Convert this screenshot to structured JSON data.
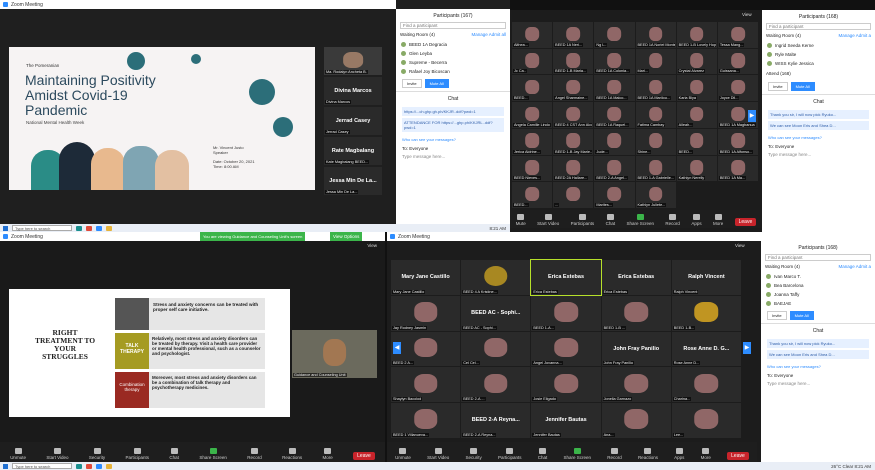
{
  "q1": {
    "window_title": "Zoom Meeting",
    "slide": {
      "brand": "The Pomeranian",
      "title1": "Maintaining Positivity",
      "title2": "Amidst Covid-19",
      "title3": "Pandemic",
      "subtitle": "National Mental Health Week",
      "speaker1": "Mr. Vincent Justo",
      "speaker2": "Speaker",
      "date": "Date: October 20, 2021",
      "time": "Time: 8:00 AM"
    },
    "side": [
      {
        "big": "",
        "name": "Ma. Rodalyn Ancheta B."
      },
      {
        "big": "Divina Marcos",
        "name": "Divina Marcos"
      },
      {
        "big": "Jerrad Casey",
        "name": "Jerrad Casey"
      },
      {
        "big": "Rate Magbalang",
        "name": "Kate Magbalang BEED..."
      },
      {
        "big": "Jessa Min De La...",
        "name": "Jessa Min De La..."
      }
    ],
    "panel": {
      "header": "Participants (167)",
      "search": "Find a participant",
      "waiting": "Waiting Room (4)",
      "manage": "Manage",
      "admit": "Admit all",
      "people": [
        "BEED 1A Degracia",
        "Glen Leyba",
        "Supreme - Becerra",
        "Rafael Joy Bicoscan"
      ],
      "btn1": "Invite",
      "btn2": "Mute All",
      "chat_header": "Chat",
      "msg1": "https://...ch.ghp.gh.ph/KKJR..ddf?pwd=1",
      "msg2": "ATTENDANCE FOR https://...ghp.ph/KKJRL..ddf?pwd=1",
      "to": "To: Everyone",
      "type": "Type message here...",
      "who": "Who can see your messages?"
    }
  },
  "q2": {
    "view": "View",
    "tiles": [
      "Althea...",
      "BEED 1A Neri...",
      "Ng L..",
      "BEED 1A Noriel Montes...",
      "BEED 1-B Lovely Hope...",
      "Tessa Mang...",
      "Jc Ca..",
      "BEED 1-B Maria...",
      "BEED 1A Colonia...",
      "Mari...",
      "Crystal Alvarez",
      "Guissana...",
      "BEED...",
      "Angel Sharmaine...",
      "BEED 1A Malco...",
      "BEED 1A Marilou...",
      "Karla Biya",
      "Joyce Dil...",
      "Angela Camille Lindo",
      "BEED 4 CST Ann Alcone",
      "BEED 1A Raquel...",
      "Fatima Cambay",
      "Alleah...",
      "BEED 1A Magbanua",
      "Jerica Aldrine...",
      "BEED 1-B Jay Marie...",
      "Jude...",
      "Shine...",
      "BEED...",
      "BEED 1A Alfonso...",
      "BEED Nieves...",
      "BEED 2A Hallare...",
      "BEED 2-A Angel...",
      "BEED 1-A Gabrielle...",
      "Kathlyn Nerelly",
      "BEED 1A Ma...",
      "BEED...",
      "...",
      "Marites...",
      "Kathlyn Juliete..."
    ],
    "panel": {
      "header": "Participants (168)",
      "search": "Find a participant",
      "waiting": "Waiting Room (4)",
      "manage": "Manage",
      "admit": "Admit a",
      "people": [
        "Ingrid Seeda Kerne",
        "Ryle Malte",
        "WISS Kylie Jessica"
      ],
      "attend": "Attend (168)",
      "btn1": "Invite",
      "btn2": "Mute All",
      "chat_header": "Chat",
      "msg1": "Thank you sir, I will now pick Ryuko...",
      "msg2": "We can see Moon Eris and Shea D...",
      "who": "Who can see your messages?",
      "to": "To: Everyone",
      "type": "Type message here..."
    },
    "ctrl": [
      "Mute",
      "Start Video",
      "Security",
      "Participants",
      "Chat",
      "Share Screen",
      "Record",
      "Reactions",
      "Apps",
      "More"
    ],
    "leave": "Leave"
  },
  "q3": {
    "window_title": "Zoom Meeting",
    "banner": "You are viewing Guidance and Counseling Unit's screen",
    "view_options": "View Options",
    "view": "View",
    "slide": {
      "heading1": "RIGHT",
      "heading2": "TREATMENT TO",
      "heading3": "YOUR",
      "heading4": "STRUGGLES",
      "rows": [
        {
          "tag": "",
          "text": "Stress and anxiety concerns can be treated with proper self care initiative."
        },
        {
          "tag": "TALK THERAPY",
          "text": "Relatively, most stress and anxiety disorders can be treated by therapy. Visit a health care provider or mental health professional, such as a counselor and psychologist."
        },
        {
          "tag": "Combination therapy",
          "text": "Moreover, most stress and anxiety disorders can be a combination of talk therapy and psychotherapy medicines."
        }
      ]
    },
    "presenter": "Guidance and Counseling Unit",
    "ctrl": [
      "Unmute",
      "Start Video",
      "Security",
      "Participants",
      "Chat",
      "Share Screen",
      "Record",
      "Reactions",
      "Apps",
      "More"
    ],
    "leave": "Leave"
  },
  "q4": {
    "window_title": "Zoom Meeting",
    "view": "View",
    "tiles": [
      {
        "big": "Mary Jane Castillo",
        "name": "Mary Jane Castillo"
      },
      {
        "big": "",
        "name": "BEED 4 A Kristine..."
      },
      {
        "big": "Erica Estebas",
        "name": "Erica Estebas"
      },
      {
        "big": "Erica Estebas",
        "name": "Erica Estebas"
      },
      {
        "big": "Ralph Vincent",
        "name": "Ralph Vincent"
      },
      {
        "big": "",
        "name": "Jay Rodney Jasmin"
      },
      {
        "big": "BEED AC - Sophi...",
        "name": "BEED AC - Sophi..."
      },
      {
        "big": "",
        "name": "BEED 1-A..."
      },
      {
        "big": "",
        "name": "BEED 1-B ..."
      },
      {
        "big": "",
        "name": "BEED 1-B..."
      },
      {
        "big": "",
        "name": "BEED 2 A..."
      },
      {
        "big": "",
        "name": "Cel Cel..."
      },
      {
        "big": "",
        "name": "Angel Jovanna..."
      },
      {
        "big": "John Fray Panilio",
        "name": "John Fray Panilio"
      },
      {
        "big": "Rose Anne D. G...",
        "name": "Rose Anne D..."
      },
      {
        "big": "",
        "name": "Shaylyn Bacolod"
      },
      {
        "big": "",
        "name": "BEED 2-A ..."
      },
      {
        "big": "",
        "name": "Josie Eligado"
      },
      {
        "big": "",
        "name": "Jonella Garnazo"
      },
      {
        "big": "",
        "name": "Charina..."
      },
      {
        "big": "",
        "name": "BEED 1 Villanueva..."
      },
      {
        "big": "BEED 2-A Reyna...",
        "name": "BEED 2-A Reyna..."
      },
      {
        "big": "Jennifer Bautas",
        "name": "Jennifer Bautas"
      },
      {
        "big": "",
        "name": "Ana..."
      },
      {
        "big": "",
        "name": "Lee..."
      }
    ],
    "panel": {
      "header": "Participants (168)",
      "search": "Find a participant",
      "waiting": "Waiting Room (4)",
      "manage": "Manage",
      "admit": "Admit a",
      "people": [
        "Ivan Marco T.",
        "Bea Barcelona",
        "Joanna Taffy",
        "BAEJAE"
      ],
      "btn1": "Invite",
      "btn2": "Mute All",
      "chat_header": "Chat",
      "msg1": "Thank you sir, I will now pick Ryuko...",
      "msg2": "We can see Moon Eris and Shea D...",
      "to": "To: Everyone",
      "type": "Type message here...",
      "who": "Who can see your messages?"
    },
    "ctrl": [
      "Unmute",
      "Start Video",
      "Security",
      "Participants",
      "Chat",
      "Share Screen",
      "Record",
      "Reactions",
      "Apps",
      "More"
    ],
    "leave": "Leave"
  },
  "taskbar": {
    "search": "Type here to search",
    "tray": "26°C Clear",
    "time": "8:21 AM"
  }
}
